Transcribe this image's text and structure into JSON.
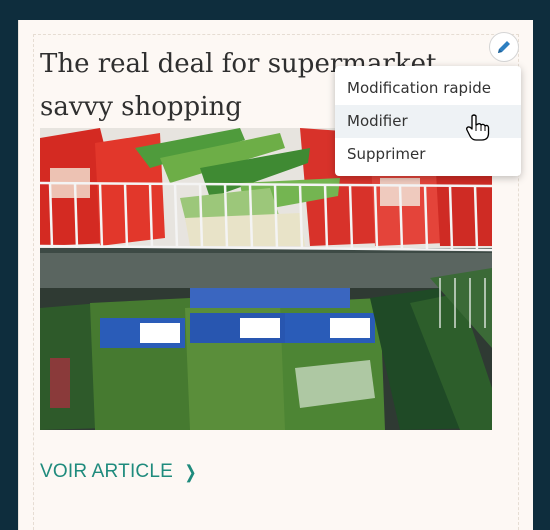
{
  "article": {
    "title": "The real deal for supermarket savvy shopping",
    "cta_label": "VOIR ARTICLE",
    "cta_icon": "chevron-right-icon",
    "image": "supermarket-fridge-photo"
  },
  "edit": {
    "icon": "pencil-icon",
    "menu": {
      "items": [
        {
          "label": "Modification rapide"
        },
        {
          "label": "Modifier"
        },
        {
          "label": "Supprimer"
        }
      ]
    }
  },
  "colors": {
    "background": "#0e2d3d",
    "card": "#fdf8f4",
    "accent": "#1f8b7d",
    "edit_icon": "#2d7fc1"
  }
}
